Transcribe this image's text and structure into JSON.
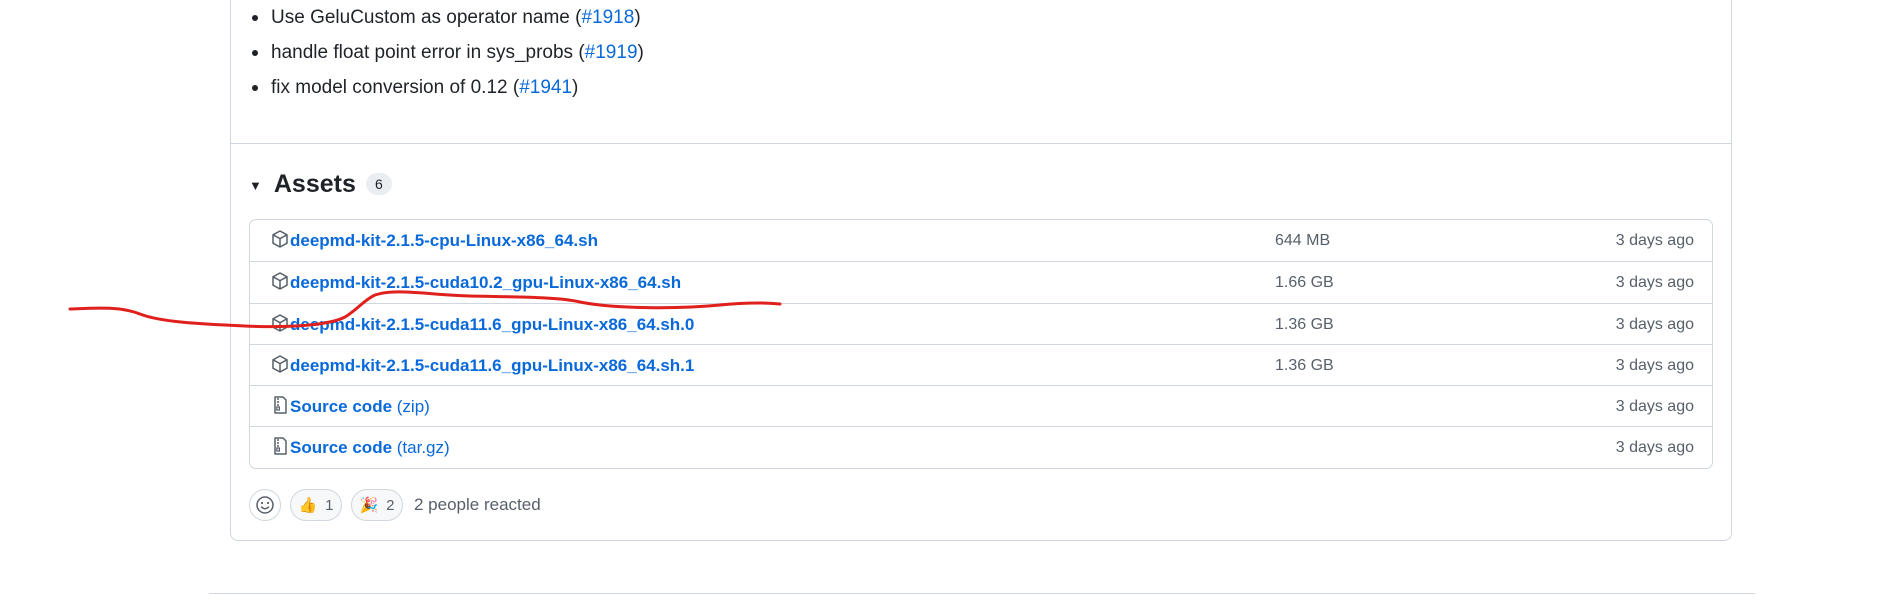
{
  "notes": {
    "items": [
      {
        "text": "Use GeluCustom as operator name (",
        "link": "#1918",
        "end": ")"
      },
      {
        "text": "handle float point error in sys_probs (",
        "link": "#1919",
        "end": ")"
      },
      {
        "text": "fix model conversion of 0.12 (",
        "link": "#1941",
        "end": ")"
      }
    ]
  },
  "assets": {
    "title": "Assets",
    "count": "6",
    "rows": [
      {
        "name": "deepmd-kit-2.1.5-cpu-Linux-x86_64.sh",
        "suffix": "",
        "size": "644 MB",
        "date": "3 days ago",
        "icon": "package-icon"
      },
      {
        "name": "deepmd-kit-2.1.5-cuda10.2_gpu-Linux-x86_64.sh",
        "suffix": "",
        "size": "1.66 GB",
        "date": "3 days ago",
        "icon": "package-icon"
      },
      {
        "name": "deepmd-kit-2.1.5-cuda11.6_gpu-Linux-x86_64.sh.0",
        "suffix": "",
        "size": "1.36 GB",
        "date": "3 days ago",
        "icon": "package-icon"
      },
      {
        "name": "deepmd-kit-2.1.5-cuda11.6_gpu-Linux-x86_64.sh.1",
        "suffix": "",
        "size": "1.36 GB",
        "date": "3 days ago",
        "icon": "package-icon"
      },
      {
        "name": "Source code",
        "suffix": " (zip)",
        "size": "",
        "date": "3 days ago",
        "icon": "file-zip-icon"
      },
      {
        "name": "Source code",
        "suffix": " (tar.gz)",
        "size": "",
        "date": "3 days ago",
        "icon": "file-zip-icon"
      }
    ]
  },
  "reactions": {
    "thumbs_up_emoji": "👍",
    "thumbs_up_count": "1",
    "tada_emoji": "🎉",
    "tada_count": "2",
    "summary": "2 people reacted"
  },
  "colors": {
    "link": "#0969da",
    "border": "#d0d7de",
    "muted_text": "#57606a",
    "annotation_stroke": "#e0201c"
  }
}
